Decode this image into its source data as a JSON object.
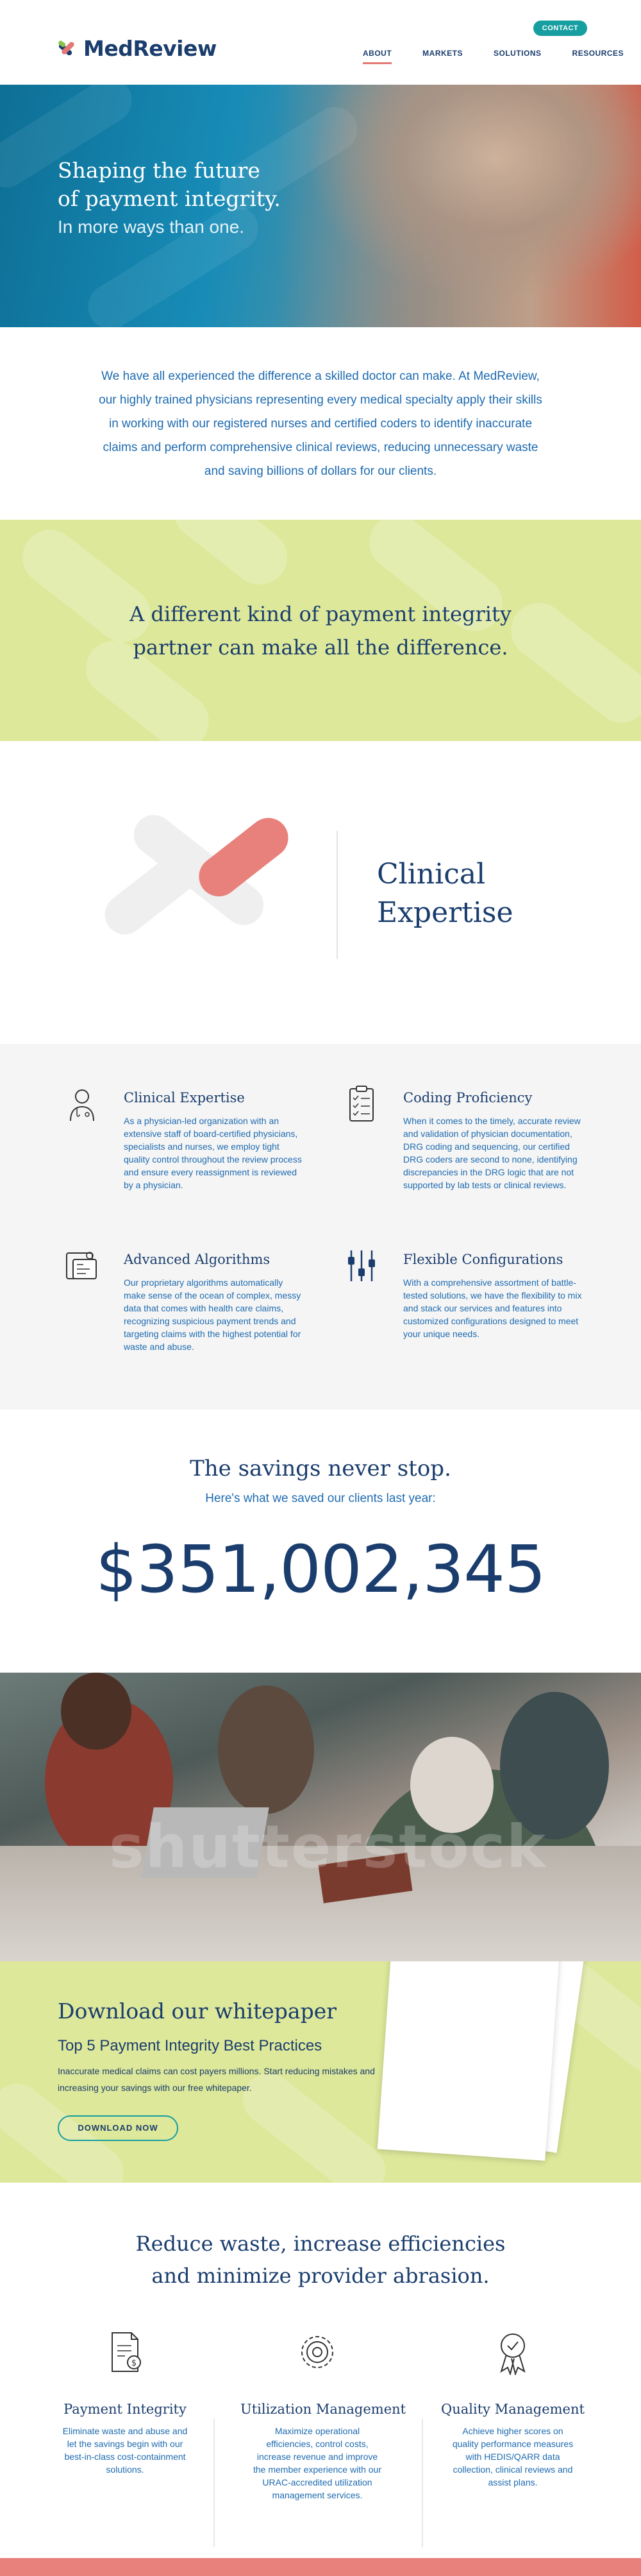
{
  "header": {
    "logo_text": "MedReview",
    "contact_label": "CONTACT",
    "nav": [
      "ABOUT",
      "MARKETS",
      "SOLUTIONS",
      "RESOURCES"
    ],
    "active_nav": "ABOUT"
  },
  "hero": {
    "title_line1": "Shaping the future",
    "title_line2": "of payment integrity.",
    "subtitle": "In more ways than one."
  },
  "intro": {
    "text": "We have all experienced the difference a skilled doctor can make. At MedReview, our highly trained physicians representing every medical specialty apply their skills in working with our registered nurses and certified coders to identify inaccurate claims and perform comprehensive clinical reviews, reducing unnecessary waste and saving billions of dollars for our clients."
  },
  "band": {
    "line1": "A different kind of payment integrity",
    "line2": "partner can make all the difference."
  },
  "clinical": {
    "line1": "Clinical",
    "line2": "Expertise"
  },
  "features": [
    {
      "title": "Clinical Expertise",
      "icon": "doctor-icon",
      "text": "As a physician-led organization with an extensive staff of board-certified physicians, specialists and nurses, we employ tight quality control throughout the review process and ensure every reassignment is reviewed by a physician."
    },
    {
      "title": "Coding Proficiency",
      "icon": "clipboard-checklist-icon",
      "text": "When it comes to the timely, accurate review and validation of physician documentation, DRG coding and sequencing, our certified DRG coders are second to none, identifying discrepancies in the DRG logic that are not supported by lab tests or clinical reviews."
    },
    {
      "title": "Advanced Algorithms",
      "icon": "algorithm-icon",
      "text": "Our proprietary algorithms automatically make sense of the ocean of complex, messy data that comes with health care claims, recognizing suspicious payment trends and targeting claims with the highest potential for waste and abuse."
    },
    {
      "title": "Flexible Configurations",
      "icon": "sliders-icon",
      "text": "With a comprehensive assortment of battle-tested solutions, we have the flexibility to mix and stack our services and features into customized configurations designed to meet your unique needs."
    }
  ],
  "savings": {
    "title": "The savings never stop.",
    "subtitle": "Here's what we saved our clients last year:",
    "amount": "$351,002,345"
  },
  "meeting": {
    "watermark": "shutterstock"
  },
  "whitepaper": {
    "title": "Download our whitepaper",
    "subtitle": "Top 5 Payment Integrity Best Practices",
    "description": "Inaccurate medical claims can cost payers millions. Start reducing mistakes and increasing your savings with our free whitepaper.",
    "button": "DOWNLOAD NOW"
  },
  "reduce": {
    "line1": "Reduce waste, increase efficiencies",
    "line2": "and minimize provider abrasion.",
    "columns": [
      {
        "title": "Payment Integrity",
        "icon": "document-dollar-icon",
        "text": "Eliminate waste and abuse and let the savings begin with our best-in-class cost-containment solutions."
      },
      {
        "title": "Utilization Management",
        "icon": "gear-icon",
        "text": "Maximize operational efficiencies, control costs, increase revenue and improve the member experience with our URAC-accredited utilization management services."
      },
      {
        "title": "Quality Management",
        "icon": "award-ribbon-icon",
        "text": "Achieve higher scores on quality performance measures with HEDIS/QARR data collection, clinical reviews and assist plans."
      }
    ]
  },
  "colors": {
    "navy": "#1a3d6d",
    "teal": "#169ea0",
    "coral": "#e47876",
    "lime": "#dde89a",
    "blue_text": "#1e6bb0"
  }
}
